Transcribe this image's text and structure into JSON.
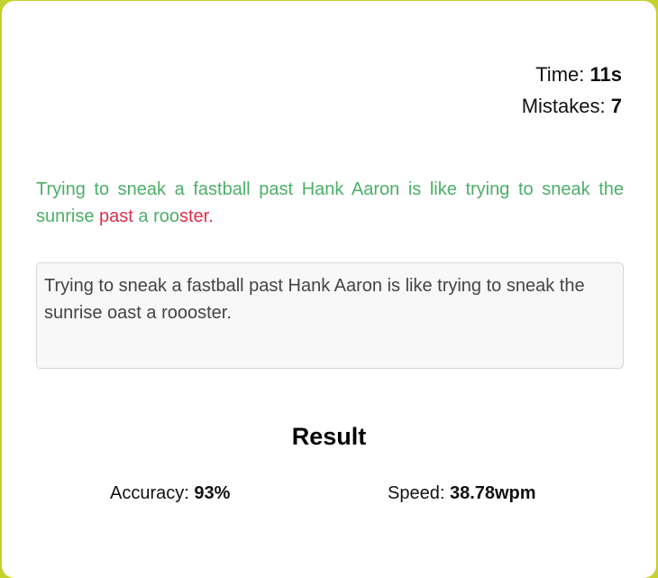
{
  "stats": {
    "time_label": "Time:",
    "time_value": "11s",
    "mistakes_label": "Mistakes:",
    "mistakes_value": "7"
  },
  "quote": {
    "segments": [
      {
        "text": "Trying to sneak a fastball past Hank Aaron is like trying to sneak the sunrise ",
        "state": "correct"
      },
      {
        "text": "past",
        "state": "incorrect"
      },
      {
        "text": " a roo",
        "state": "correct"
      },
      {
        "text": "ster.",
        "state": "incorrect"
      }
    ]
  },
  "input": {
    "value": "Trying to sneak a fastball past Hank Aaron is like trying to sneak the sunrise oast a roooster."
  },
  "result": {
    "title": "Result",
    "accuracy_label": "Accuracy:",
    "accuracy_value": "93%",
    "speed_label": "Speed:",
    "speed_value": "38.78wpm"
  },
  "colors": {
    "correct": "#4caf68",
    "incorrect": "#dc2f4b",
    "border": "#c5d12e"
  }
}
